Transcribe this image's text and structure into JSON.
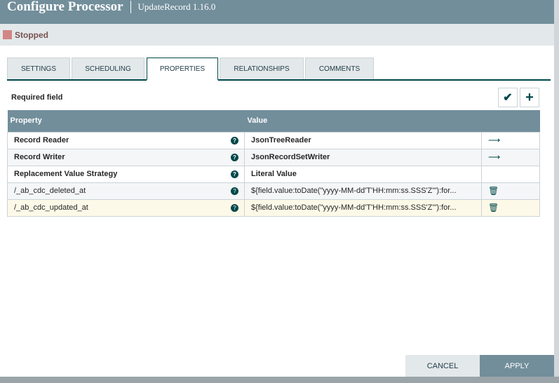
{
  "header": {
    "title": "Configure Processor",
    "subtitle": "UpdateRecord 1.16.0"
  },
  "status": {
    "label": "Stopped",
    "color": "#d18686"
  },
  "tabs": [
    {
      "label": "SETTINGS"
    },
    {
      "label": "SCHEDULING"
    },
    {
      "label": "PROPERTIES"
    },
    {
      "label": "RELATIONSHIPS"
    },
    {
      "label": "COMMENTS"
    }
  ],
  "active_tab": "PROPERTIES",
  "required_field": "Required field",
  "table": {
    "columns": [
      "Property",
      "Value"
    ],
    "rows": [
      {
        "property": "Record Reader",
        "value": "JsonTreeReader",
        "action": "arrow-right-icon"
      },
      {
        "property": "Record Writer",
        "value": "JsonRecordSetWriter",
        "action": "arrow-right-icon"
      },
      {
        "property": "Replacement Value Strategy",
        "value": "Literal Value",
        "action": ""
      },
      {
        "property": "/_ab_cdc_deleted_at",
        "value": "${field.value:toDate(\"yyyy-MM-dd'T'HH:mm:ss.SSS'Z'\"):for...",
        "action": "trash-icon"
      },
      {
        "property": "/_ab_cdc_updated_at",
        "value": "${field.value:toDate(\"yyyy-MM-dd'T'HH:mm:ss.SSS'Z'\"):for...",
        "action": "trash-icon"
      }
    ]
  },
  "buttons": {
    "cancel": "CANCEL",
    "apply": "APPLY"
  }
}
